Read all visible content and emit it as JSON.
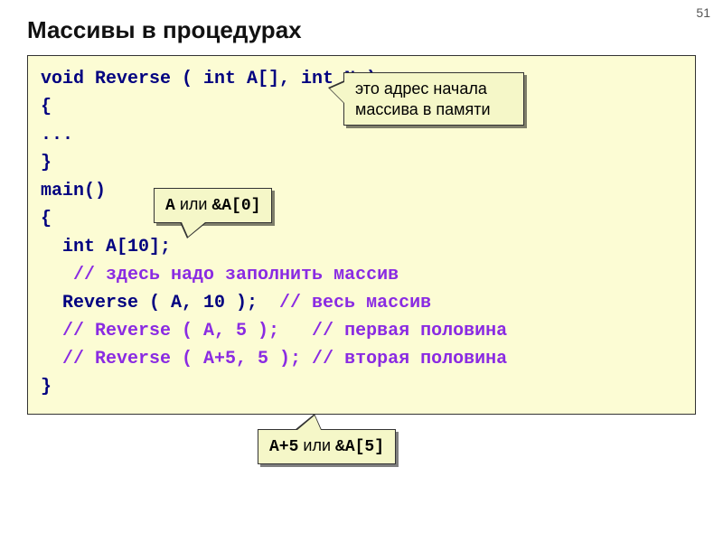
{
  "page_number": "51",
  "title": "Массивы в процедурах",
  "code": {
    "l1": "void Reverse ( int A[], int N )",
    "l2": "{",
    "l3": "...",
    "l4": "}",
    "l5": "main()",
    "l6": "{",
    "l7": "  int A[10];",
    "l8a": "   ",
    "l8b": "// здесь надо заполнить массив",
    "l9a": "  Reverse ( A, 10 );  ",
    "l9b": "// весь массив",
    "l10a": "  ",
    "l10b": "// Reverse ( A, 5 );   // первая половина",
    "l11a": "  ",
    "l11b": "// Reverse ( A+5, 5 ); // вторая половина",
    "l12": "}"
  },
  "callouts": {
    "c1_line1": "это адрес начала",
    "c1_line2": "массива в памяти",
    "c2_prefix": "A",
    "c2_mid": " или ",
    "c2_suffix": "&A[0]",
    "c3_prefix": "A+5",
    "c3_mid": " или ",
    "c3_suffix": "&A[5]"
  }
}
